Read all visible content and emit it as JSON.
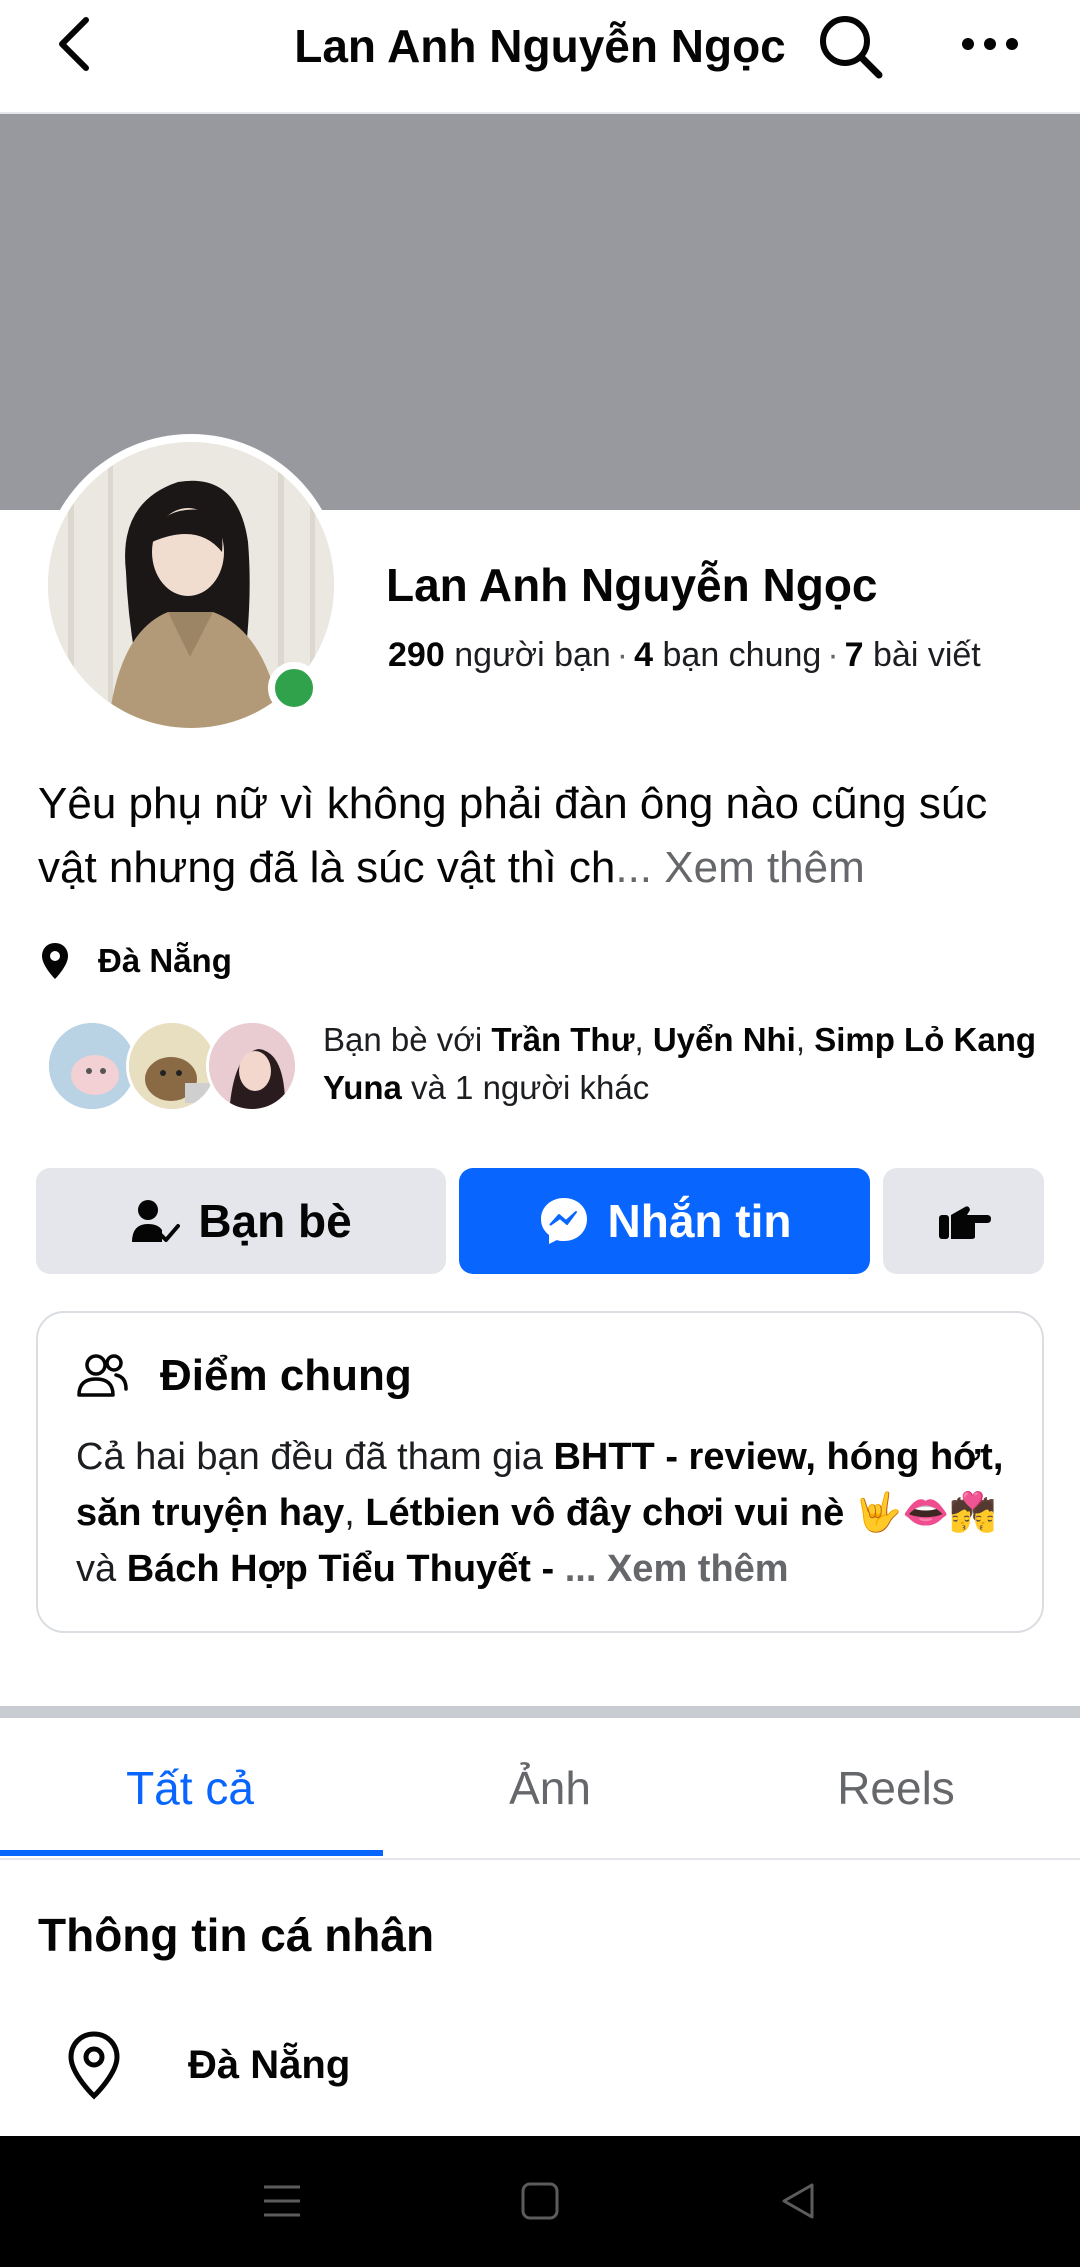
{
  "header": {
    "title": "Lan Anh Nguyễn Ngọc",
    "back_icon": "chevron-left-icon",
    "search_icon": "search-icon",
    "more_icon": "more-dots-icon"
  },
  "profile": {
    "name": "Lan Anh Nguyễn Ngọc",
    "online": true,
    "stats": {
      "friends_count": "290",
      "friends_label": "người bạn",
      "mutual_count": "4",
      "mutual_label": "bạn chung",
      "posts_count": "7",
      "posts_label": "bài viết",
      "separator": "·"
    },
    "bio": "Yêu phụ nữ vì không phải đàn ông nào cũng súc vật nhưng đã là súc vật thì ch",
    "bio_more": "... Xem thêm",
    "location": "Đà Nẵng"
  },
  "mutual_friends": {
    "prefix": "Bạn bè với ",
    "name1": "Trần Thư",
    "comma": ", ",
    "name2": "Uyển Nhi",
    "name3": "Simp Lỏ Kang Yuna",
    "suffix": " và 1 người khác"
  },
  "actions": {
    "friends_label": "Bạn bè",
    "message_label": "Nhắn tin",
    "poke_icon": "poke-hand-icon"
  },
  "common": {
    "title": "Điểm chung",
    "text_prefix": "Cả hai bạn đều đã tham gia ",
    "group1": "BHTT - review, hóng hớt, săn truyện hay",
    "comma": ", ",
    "group2": "Létbien vô đây chơi vui nè 🤟👄💏",
    "and": " và ",
    "group3": "Bách Hợp Tiểu Thuyết -",
    "more": " ... Xem thêm"
  },
  "tabs": [
    {
      "label": "Tất cả",
      "active": true
    },
    {
      "label": "Ảnh",
      "active": false
    },
    {
      "label": "Reels",
      "active": false
    }
  ],
  "personal_info": {
    "title": "Thông tin cá nhân",
    "location": "Đà Nẵng"
  },
  "colors": {
    "accent": "#0866ff",
    "online": "#31a24c",
    "cover": "#97999e"
  }
}
